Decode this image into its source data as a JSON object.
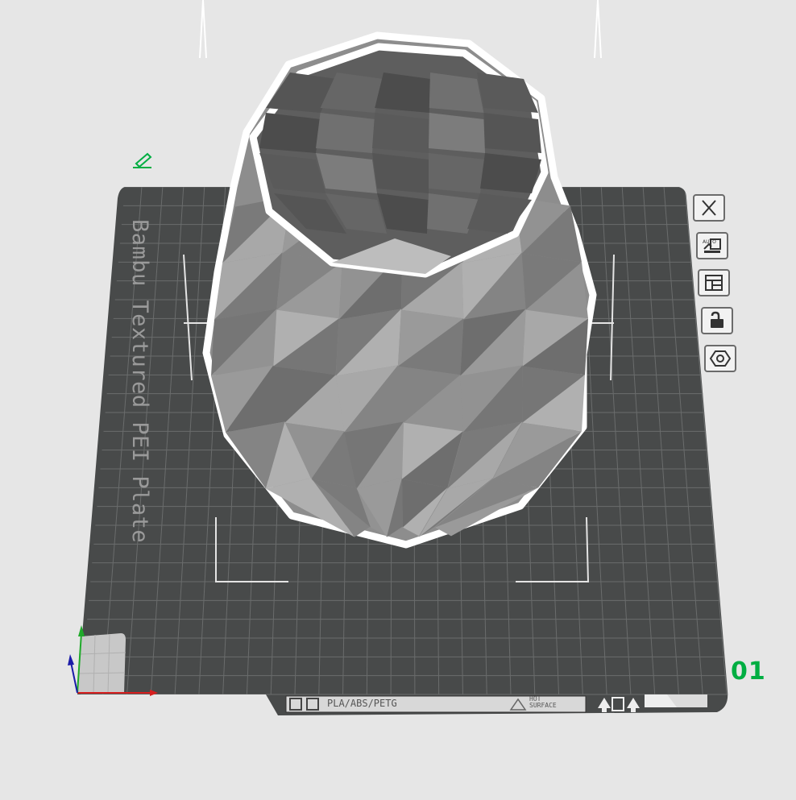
{
  "plate": {
    "name": "Bambu Textured PEI Plate",
    "number": "01",
    "material_label": "PLA/ABS/PETG",
    "warning_label_line1": "HOT",
    "warning_label_line2": "SURFACE"
  },
  "toolbar": {
    "items": [
      {
        "icon": "close-icon"
      },
      {
        "icon": "auto-arrange-icon",
        "label": "AUTO"
      },
      {
        "icon": "plate-layout-icon"
      },
      {
        "icon": "lock-icon"
      },
      {
        "icon": "plate-settings-icon"
      }
    ]
  },
  "colors": {
    "background": "#e6e6e6",
    "plate": "#484a4a",
    "accent": "#00ae42",
    "model": "#8c8c8c",
    "selection_outline": "#ffffff"
  }
}
